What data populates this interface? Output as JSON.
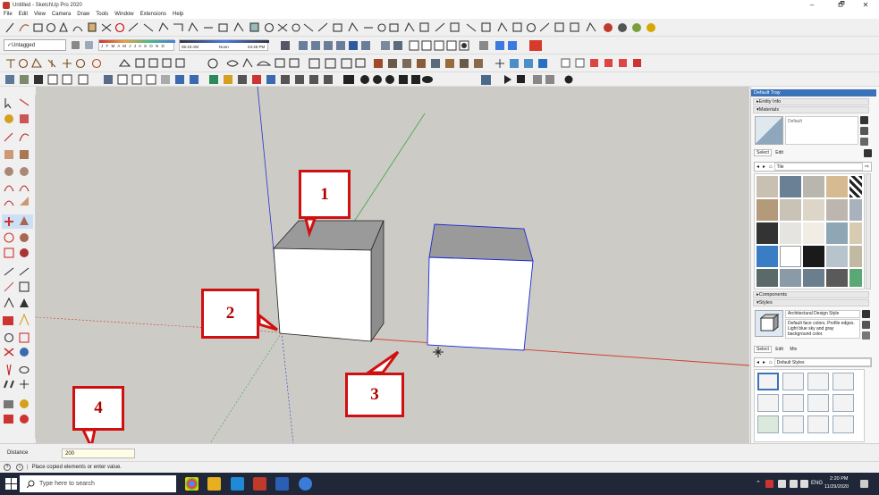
{
  "window": {
    "title": "Untitled - SketchUp Pro 2020",
    "min": "–",
    "max": "🗗",
    "close": "✕"
  },
  "menu": [
    "File",
    "Edit",
    "View",
    "Camera",
    "Draw",
    "Tools",
    "Window",
    "Extensions",
    "Help"
  ],
  "layers": {
    "value": "Untagged"
  },
  "shadow": {
    "months": "J F M A M J J A S O N D",
    "time_start": "06:43 AM",
    "time_noon": "Noon",
    "time_end": "04:45 PM"
  },
  "callouts": [
    "1",
    "2",
    "3",
    "4"
  ],
  "tray": {
    "title": "Default Tray",
    "entity_info": "Entity Info",
    "materials": "Materials",
    "material_name": "Default",
    "select_tab": "Select",
    "edit_tab": "Edit",
    "library": "Tile",
    "components": "Components",
    "styles": "Styles",
    "style_name": "Architectural Design Style",
    "style_desc": "Default face colors. Profile edges. Light blue sky and gray background color.",
    "styles_tabs": [
      "Select",
      "Edit",
      "Mix"
    ],
    "styles_library": "Default Styles"
  },
  "measurement": {
    "label": "Distance",
    "value": "200"
  },
  "status": {
    "text": "Place copied elements or enter value."
  },
  "taskbar": {
    "search_placeholder": "Type here to search",
    "lang": "ENG",
    "time": "2:20 PM",
    "date": "11/29/2020"
  },
  "colors": {
    "accent_red": "#d01010",
    "selection_blue": "#1a2bd8",
    "viewport_bg": "#cccbc6",
    "taskbar": "#1f2738"
  }
}
